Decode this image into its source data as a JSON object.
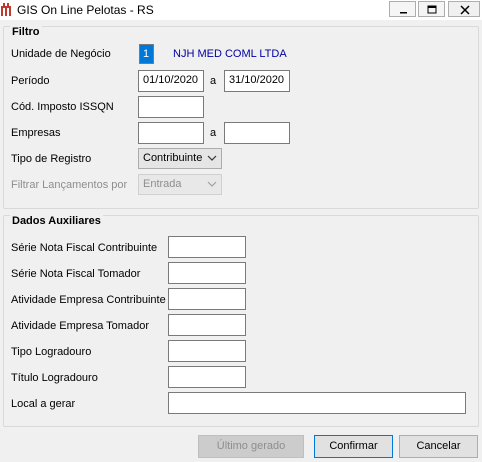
{
  "window": {
    "title": "GIS On Line Pelotas - RS",
    "controls": [
      "minimize",
      "maximize",
      "close"
    ]
  },
  "filtro": {
    "title": "Filtro",
    "unidade_label": "Unidade de Negócio",
    "unidade_code": "1",
    "unidade_name": "NJH MED COML LTDA",
    "periodo_label": "Período",
    "periodo_start": "01/10/2020",
    "periodo_sep": "a",
    "periodo_end": "31/10/2020",
    "imposto_label": "Cód. Imposto ISSQN",
    "imposto_value": "",
    "empresas_label": "Empresas",
    "empresas_sep": "a",
    "empresas_start": "",
    "empresas_end": "",
    "tipo_label": "Tipo de Registro",
    "tipo_value": "Contribuinte",
    "lancamentos_label": "Filtrar Lançamentos por",
    "lancamentos_value": "Entrada"
  },
  "auxiliares": {
    "title": "Dados Auxiliares",
    "serie_contrib_label": "Série Nota Fiscal Contribuinte",
    "serie_tomador_label": "Série Nota Fiscal Tomador",
    "atividade_contrib_label": "Atividade Empresa Contribuinte",
    "atividade_tomador_label": "Atividade Empresa Tomador",
    "tipo_logradouro_label": "Tipo Logradouro",
    "titulo_logradouro_label": "Título Logradouro",
    "local_label": "Local a gerar"
  },
  "buttons": {
    "ultimo": "Último gerado",
    "confirmar": "Confirmar",
    "cancelar": "Cancelar"
  },
  "colors": {
    "window_bg": "#f0f0f0",
    "selection": "#0078d7",
    "company_text": "#0000a0"
  }
}
